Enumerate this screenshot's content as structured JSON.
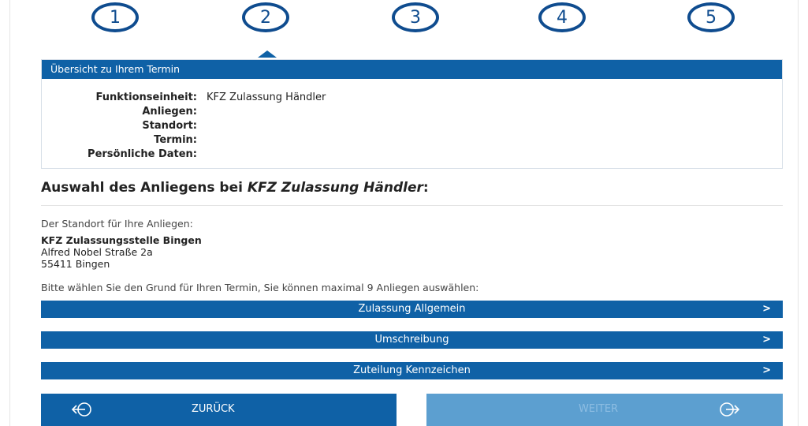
{
  "steps": [
    "1",
    "2",
    "3",
    "4",
    "5"
  ],
  "overview": {
    "header": "Übersicht zu Ihrem Termin",
    "rows": [
      {
        "label": "Funktionseinheit:",
        "value": "KFZ Zulassung Händler"
      },
      {
        "label": "Anliegen:",
        "value": ""
      },
      {
        "label": "Standort:",
        "value": ""
      },
      {
        "label": "Termin:",
        "value": ""
      },
      {
        "label": "Persönliche Daten:",
        "value": ""
      }
    ]
  },
  "section": {
    "title_prefix": "Auswahl des Anliegens bei ",
    "title_unit": "KFZ Zulassung Händler",
    "title_suffix": ":"
  },
  "location": {
    "label": "Der Standort für Ihre Anliegen:",
    "name": "KFZ Zulassungsstelle Bingen",
    "street": "Alfred Nobel Straße 2a",
    "city": "55411 Bingen"
  },
  "instruction": "Bitte wählen Sie den Grund für Ihren Termin, Sie können maximal 9 Anliegen auswählen:",
  "concerns": [
    "Zulassung Allgemein",
    "Umschreibung",
    "Zuteilung Kennzeichen"
  ],
  "nav": {
    "back_label": "ZURÜCK",
    "next_label": "WEITER"
  },
  "colors": {
    "primary": "#0f61a6",
    "step_ring": "#0f4c8f",
    "disabled": "#5c9fd0"
  }
}
